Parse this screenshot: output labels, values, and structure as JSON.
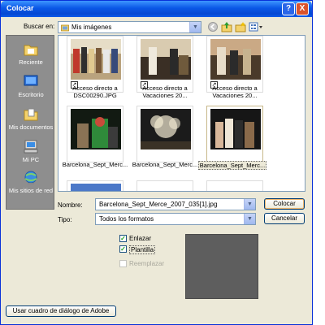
{
  "window": {
    "title": "Colocar",
    "help_label": "?",
    "close_label": "X"
  },
  "toolbar": {
    "lookin_label": "Buscar en:",
    "lookin_value": "Mis imágenes",
    "icons": [
      "back-icon",
      "up-folder-icon",
      "new-folder-icon",
      "views-menu-icon"
    ]
  },
  "places": [
    {
      "label": "Reciente",
      "icon": "recent-documents-icon"
    },
    {
      "label": "Escritorio",
      "icon": "desktop-icon"
    },
    {
      "label": "Mis documentos",
      "icon": "my-documents-icon"
    },
    {
      "label": "Mi PC",
      "icon": "my-computer-icon"
    },
    {
      "label": "Mis sitios de red",
      "icon": "network-places-icon"
    }
  ],
  "files": [
    {
      "caption": "Acceso directo a DSC00290.JPG",
      "line1": "Acceso directo a",
      "line2": "DSC00290.JPG",
      "shortcut": true
    },
    {
      "caption": "Acceso directo a Vacaciones 20...",
      "line1": "Acceso directo a",
      "line2": "Vacaciones 20...",
      "shortcut": true
    },
    {
      "caption": "Acceso directo a Vacaciones 20...",
      "line1": "Acceso directo a",
      "line2": "Vacaciones 20...",
      "shortcut": true
    },
    {
      "caption": "Barcelona_Sept_Merc...",
      "line1": "Barcelona_Sept_Merc...",
      "line2": "",
      "shortcut": false
    },
    {
      "caption": "Barcelona_Sept_Merc...",
      "line1": "Barcelona_Sept_Merc...",
      "line2": "",
      "shortcut": false
    },
    {
      "caption": "Barcelona_Sept_Merc...",
      "line1": "Barcelona_Sept_Merc...",
      "line2": "",
      "shortcut": false,
      "selected": true
    }
  ],
  "form": {
    "name_label": "Nombre:",
    "name_value": "Barcelona_Sept_Merce_2007_035[1].jpg",
    "type_label": "Tipo:",
    "type_value": "Todos los formatos",
    "open_button": "Colocar",
    "cancel_button": "Cancelar"
  },
  "options": {
    "link_label": "Enlazar",
    "link_checked": true,
    "template_label": "Plantilla",
    "template_checked": true,
    "replace_label": "Reemplazar",
    "replace_checked": false
  },
  "footer": {
    "adobe_dialog_button": "Usar cuadro de diálogo de Adobe"
  }
}
